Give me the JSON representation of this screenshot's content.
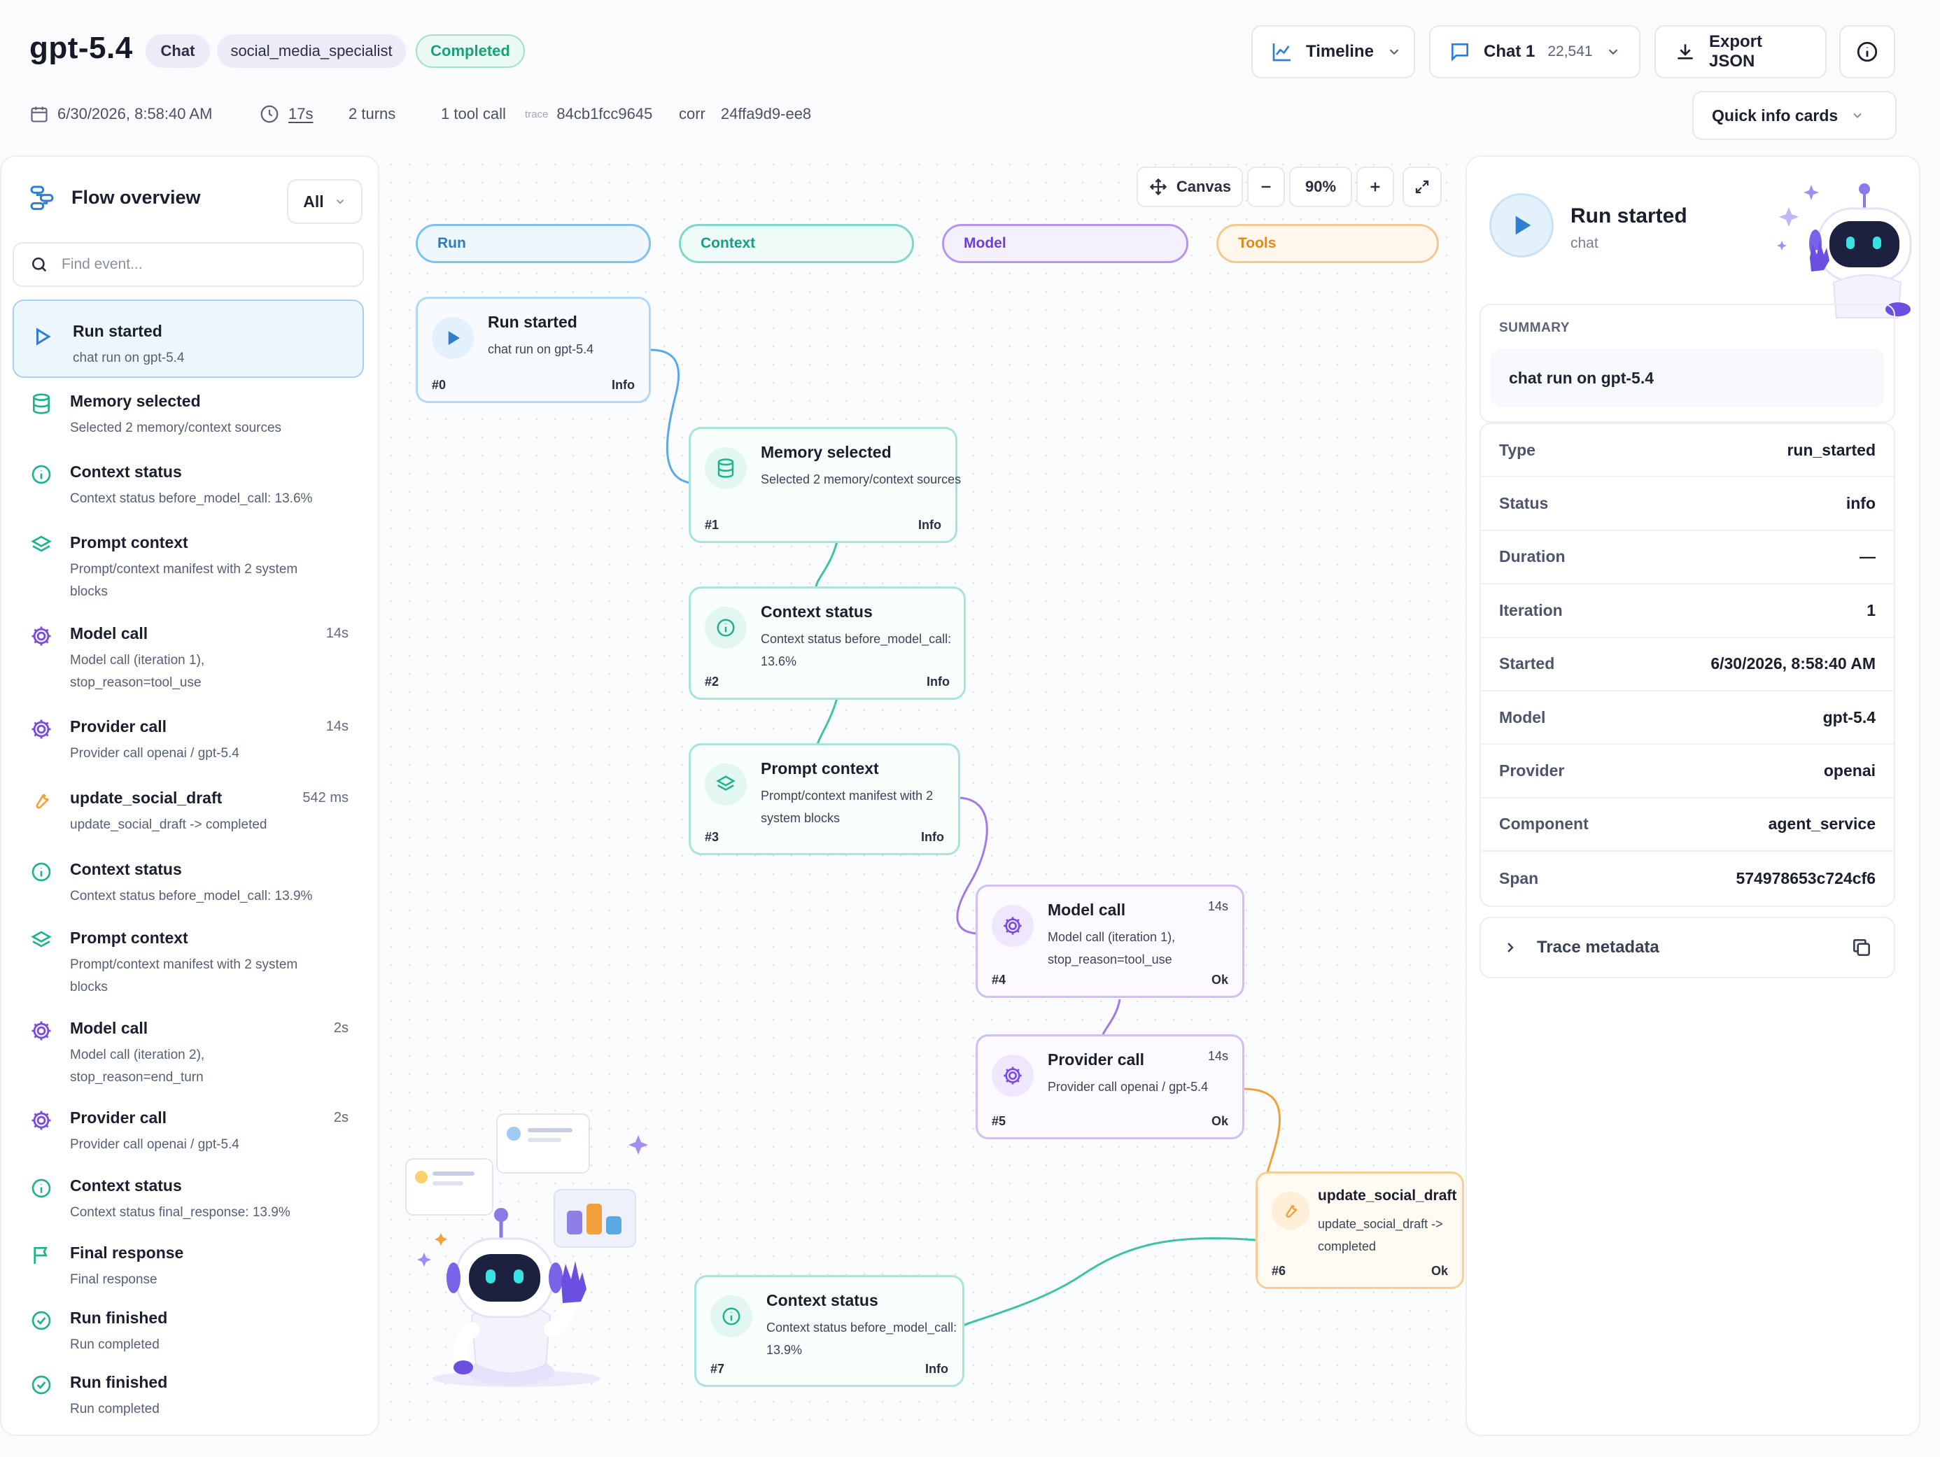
{
  "header": {
    "title": "gpt-5.4",
    "badges": {
      "chat": "Chat",
      "agent": "social_media_specialist",
      "status": "Completed"
    },
    "meta": {
      "date": "6/30/2026, 8:58:40 AM",
      "duration": "17s",
      "turns": "2 turns",
      "tool_calls": "1 tool call",
      "trace_label": "trace",
      "trace_id": "84cb1fcc9645",
      "corr_label": "corr",
      "corr_id": "24ffa9d9-ee8"
    },
    "buttons": {
      "timeline": "Timeline",
      "chat": "Chat 1",
      "chat_count": "22,541",
      "export": "Export JSON",
      "quick_info": "Quick info cards"
    }
  },
  "flow": {
    "title": "Flow overview",
    "filter": "All",
    "search_placeholder": "Find event...",
    "events": [
      {
        "title": "Run started",
        "desc": "chat run on gpt-5.4",
        "dur": "",
        "icon": "play-icon"
      },
      {
        "title": "Memory selected",
        "desc": "Selected 2 memory/context sources",
        "dur": "",
        "icon": "database-icon"
      },
      {
        "title": "Context status",
        "desc": "Context status before_model_call: 13.6%",
        "dur": "",
        "icon": "info-icon"
      },
      {
        "title": "Prompt context",
        "desc": "Prompt/context manifest with 2 system blocks",
        "dur": "",
        "icon": "layers-icon"
      },
      {
        "title": "Model call",
        "desc": "Model call (iteration 1), stop_reason=tool_use",
        "dur": "14s",
        "icon": "model-gear-icon"
      },
      {
        "title": "Provider call",
        "desc": "Provider call openai / gpt-5.4",
        "dur": "14s",
        "icon": "provider-gear-icon"
      },
      {
        "title": "update_social_draft",
        "desc": "update_social_draft -> completed",
        "dur": "542 ms",
        "icon": "wrench-icon"
      },
      {
        "title": "Context status",
        "desc": "Context status before_model_call: 13.9%",
        "dur": "",
        "icon": "info-icon"
      },
      {
        "title": "Prompt context",
        "desc": "Prompt/context manifest with 2 system blocks",
        "dur": "",
        "icon": "layers-icon"
      },
      {
        "title": "Model call",
        "desc": "Model call (iteration 2), stop_reason=end_turn",
        "dur": "2s",
        "icon": "model-gear-icon"
      },
      {
        "title": "Provider call",
        "desc": "Provider call openai / gpt-5.4",
        "dur": "2s",
        "icon": "provider-gear-icon"
      },
      {
        "title": "Context status",
        "desc": "Context status final_response: 13.9%",
        "dur": "",
        "icon": "info-icon"
      },
      {
        "title": "Final response",
        "desc": "Final response",
        "dur": "",
        "icon": "flag-icon"
      },
      {
        "title": "Run finished",
        "desc": "Run completed",
        "dur": "",
        "icon": "check-circle-icon"
      },
      {
        "title": "Run finished",
        "desc": "Run completed",
        "dur": "",
        "icon": "check-circle-icon"
      }
    ]
  },
  "canvas": {
    "mode": "Canvas",
    "zoom": "90%",
    "lanes": {
      "run": "Run",
      "context": "Context",
      "model": "Model",
      "tools": "Tools"
    },
    "nodes": [
      {
        "title": "Run started",
        "desc": "chat run on gpt-5.4",
        "idx": "#0",
        "status": "Info",
        "dur": ""
      },
      {
        "title": "Memory selected",
        "desc": "Selected 2 memory/context sources",
        "idx": "#1",
        "status": "Info",
        "dur": ""
      },
      {
        "title": "Context status",
        "desc": "Context status before_model_call: 13.6%",
        "idx": "#2",
        "status": "Info",
        "dur": ""
      },
      {
        "title": "Prompt context",
        "desc": "Prompt/context manifest with 2 system blocks",
        "idx": "#3",
        "status": "Info",
        "dur": ""
      },
      {
        "title": "Model call",
        "desc": "Model call (iteration 1), stop_reason=tool_use",
        "idx": "#4",
        "status": "Ok",
        "dur": "14s"
      },
      {
        "title": "Provider call",
        "desc": "Provider call openai / gpt-5.4",
        "idx": "#5",
        "status": "Ok",
        "dur": "14s"
      },
      {
        "title": "update_social_draft",
        "desc": "update_social_draft -> completed",
        "idx": "#6",
        "status": "Ok",
        "dur": ""
      },
      {
        "title": "Context status",
        "desc": "Context status before_model_call: 13.9%",
        "idx": "#7",
        "status": "Info",
        "dur": ""
      }
    ]
  },
  "details": {
    "title": "Run started",
    "subtitle": "chat",
    "summary_label": "SUMMARY",
    "summary": "chat run on gpt-5.4",
    "fields": [
      {
        "key": "Type",
        "value": "run_started"
      },
      {
        "key": "Status",
        "value": "info"
      },
      {
        "key": "Duration",
        "value": "—"
      },
      {
        "key": "Iteration",
        "value": "1"
      },
      {
        "key": "Started",
        "value": "6/30/2026, 8:58:40 AM"
      },
      {
        "key": "Model",
        "value": "gpt-5.4"
      },
      {
        "key": "Provider",
        "value": "openai"
      },
      {
        "key": "Component",
        "value": "agent_service"
      },
      {
        "key": "Span",
        "value": "574978653c724cf6"
      }
    ],
    "trace_metadata": "Trace metadata"
  },
  "colors": {
    "run": "#3a8fdc",
    "context": "#1fb28f",
    "model": "#7a4be0",
    "tools": "#f0a13a",
    "completed": "#16a37a"
  }
}
